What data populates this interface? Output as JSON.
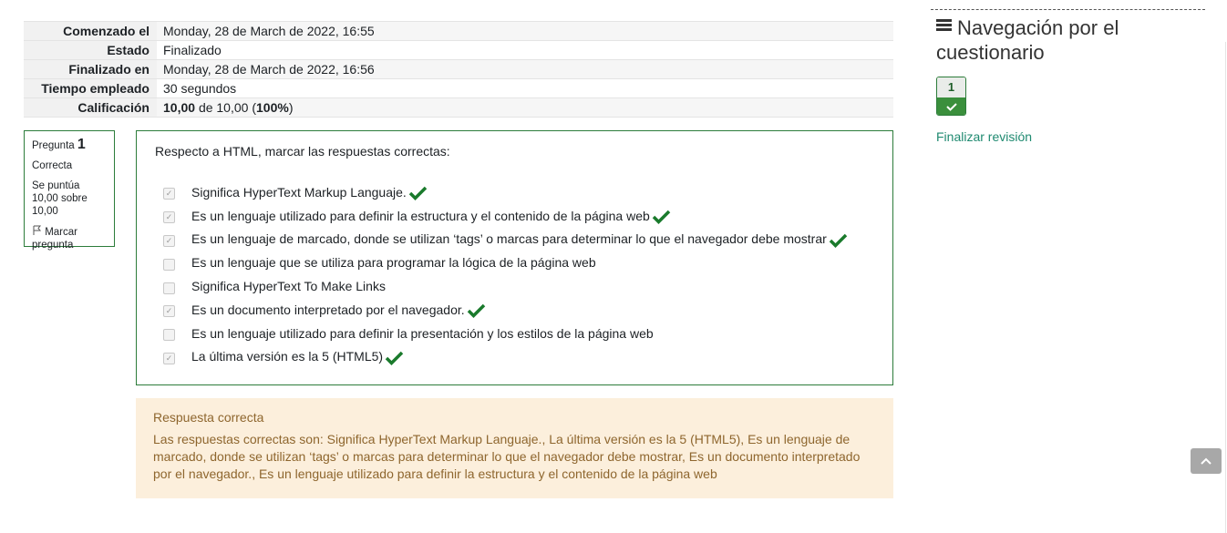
{
  "summary": [
    {
      "label": "Comenzado el",
      "value": "Monday, 28 de March de 2022, 16:55"
    },
    {
      "label": "Estado",
      "value": "Finalizado"
    },
    {
      "label": "Finalizado en",
      "value": "Monday, 28 de March de 2022, 16:56"
    },
    {
      "label": "Tiempo empleado",
      "value": "30 segundos"
    },
    {
      "label": "Calificación",
      "grade": "10,00",
      "of": "de 10,00 (",
      "percent": "100%",
      "close": ")"
    }
  ],
  "question_info": {
    "prefix": "Pregunta",
    "number": "1",
    "state": "Correcta",
    "grade": "Se puntúa 10,00 sobre 10,00",
    "flag_label": "Marcar pregunta"
  },
  "question": {
    "text": "Respecto a HTML, marcar las respuestas correctas:",
    "options": [
      {
        "label": "Significa HyperText Markup Languaje.",
        "checked": true,
        "correct": true
      },
      {
        "label": "Es un lenguaje utilizado para definir la estructura y el contenido de la página web",
        "checked": true,
        "correct": true
      },
      {
        "label": "Es un lenguaje de marcado, donde se utilizan ‘tags’ o marcas para determinar lo que el navegador debe mostrar",
        "checked": true,
        "correct": true
      },
      {
        "label": "Es un lenguaje que se utiliza para programar la lógica de la página web",
        "checked": false,
        "correct": false
      },
      {
        "label": "Significa HyperText To Make Links",
        "checked": false,
        "correct": false
      },
      {
        "label": "Es un documento interpretado por el navegador.",
        "checked": true,
        "correct": true
      },
      {
        "label": "Es un lenguaje utilizado para definir la presentación y los estilos de la página web",
        "checked": false,
        "correct": false
      },
      {
        "label": "La última versión es la 5 (HTML5)",
        "checked": true,
        "correct": true
      }
    ]
  },
  "feedback": {
    "title": "Respuesta correcta",
    "text": "Las respuestas correctas son: Significa HyperText Markup Languaje., La última versión es la 5 (HTML5), Es un lenguaje de marcado, donde se utilizan ‘tags’ o marcas para determinar lo que el navegador debe mostrar, Es un documento interpretado por el navegador., Es un lenguaje utilizado para definir la estructura y el contenido de la página web"
  },
  "nav": {
    "title": "Navegación por el cuestionario",
    "question_button": "1",
    "finish_link": "Finalizar revisión"
  },
  "colors": {
    "correct": "#1a7a2c",
    "feedback_bg": "#fcefdc",
    "link": "#1f8a70"
  },
  "icons": {
    "menu": "hamburger-icon",
    "check": "checkmark-icon",
    "flag": "flag-icon",
    "scroll_top": "chevron-up-icon"
  }
}
